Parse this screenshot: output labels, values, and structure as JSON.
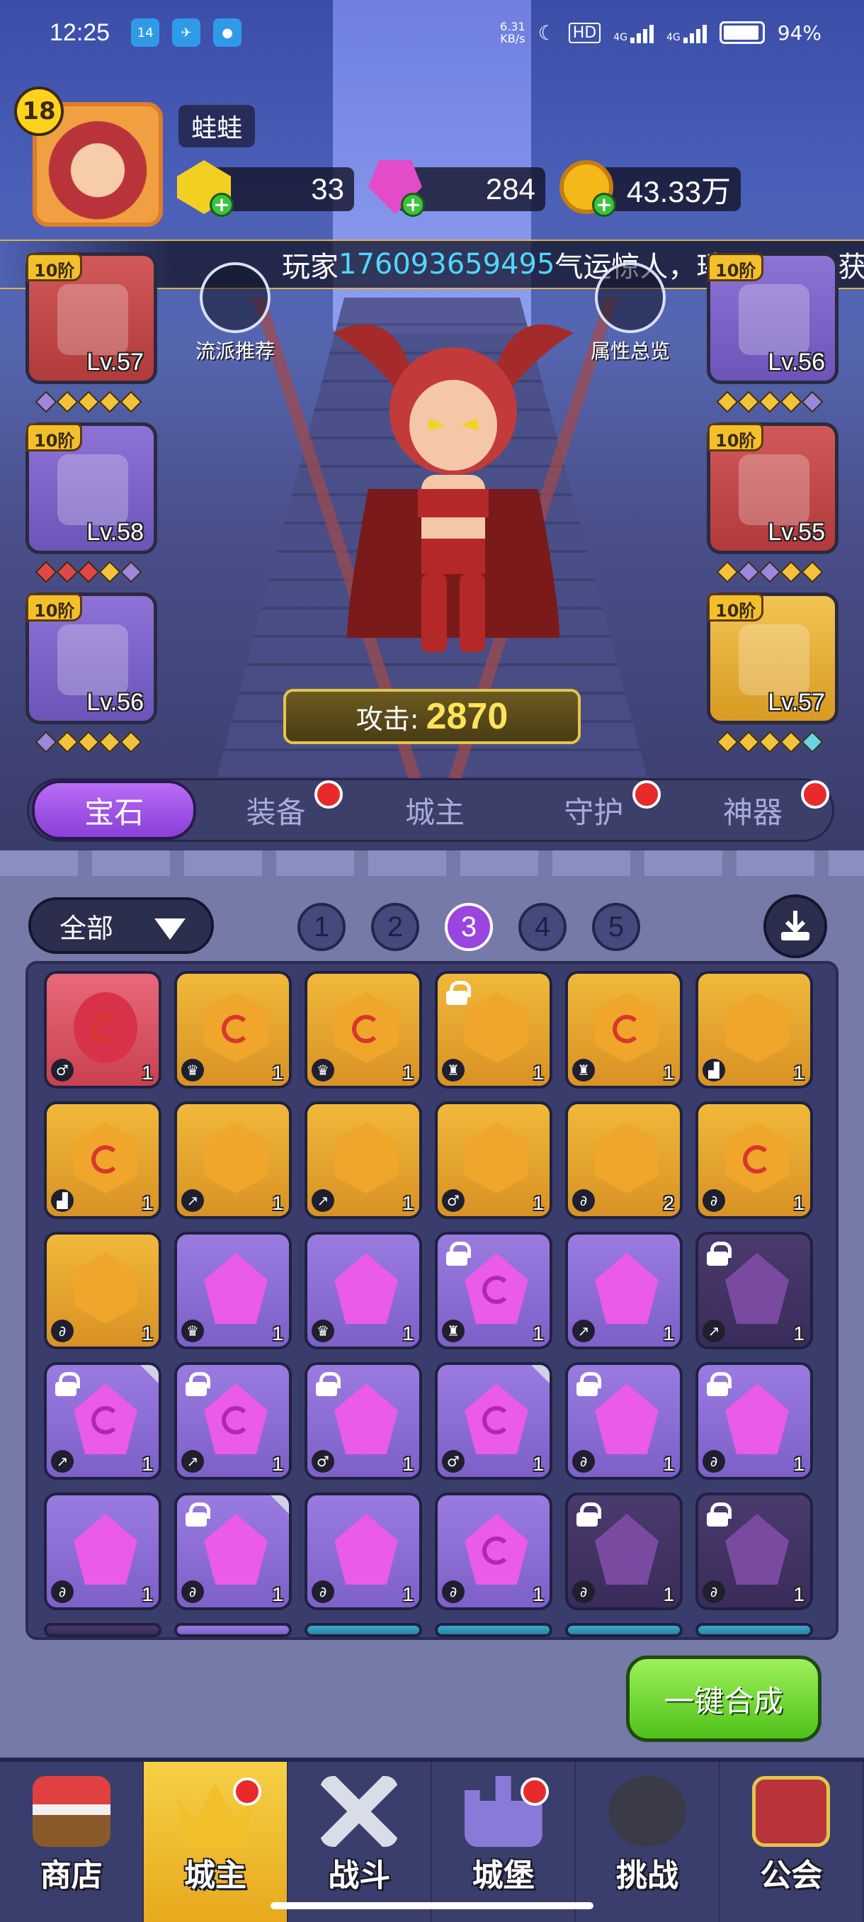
{
  "status_bar": {
    "time": "12:25",
    "app_badge": "14",
    "net_speed_value": "6.31",
    "net_speed_unit": "KB/s",
    "hd_label": "HD",
    "network": "4G",
    "battery": "94%"
  },
  "player": {
    "level": "18",
    "name": "蛙蛙"
  },
  "currencies": {
    "yellow_gem": "33",
    "pink_gem": "284",
    "gold": "43.33万"
  },
  "marquee": {
    "prefix": "玩家",
    "player_id": "176093659495",
    "suffix": "气运惊人，璀璨宝箱中获"
  },
  "buttons": {
    "recommend": "流派推荐",
    "attributes": "属性总览"
  },
  "equipment": {
    "left": [
      {
        "tier": "10阶",
        "level": "Lv.57"
      },
      {
        "tier": "10阶",
        "level": "Lv.58"
      },
      {
        "tier": "10阶",
        "level": "Lv.56"
      }
    ],
    "right": [
      {
        "tier": "10阶",
        "level": "Lv.56"
      },
      {
        "tier": "10阶",
        "level": "Lv.55"
      },
      {
        "tier": "10阶",
        "level": "Lv.57"
      }
    ]
  },
  "attack": {
    "label": "攻击:",
    "value": "2870"
  },
  "tabs": [
    "宝石",
    "装备",
    "城主",
    "守护",
    "神器"
  ],
  "filter": {
    "label": "全部"
  },
  "pages": [
    "1",
    "2",
    "3",
    "4",
    "5"
  ],
  "inventory": {
    "qty": [
      "1",
      "1",
      "1",
      "1",
      "1",
      "1",
      "1",
      "1",
      "1",
      "1",
      "2",
      "1",
      "1",
      "1",
      "1",
      "1",
      "1",
      "1",
      "1",
      "1",
      "1",
      "1",
      "1",
      "1",
      "1",
      "1",
      "1",
      "1",
      "1",
      "1"
    ]
  },
  "merge_button": "一键合成",
  "bottom_nav": [
    "商店",
    "城主",
    "战斗",
    "城堡",
    "挑战",
    "公会"
  ],
  "colors": {
    "accent_purple": "#9a45e0",
    "marquee_highlight": "#4fd8ff",
    "merge_green": "#4ec21a",
    "active_nav": "#f5d046"
  }
}
